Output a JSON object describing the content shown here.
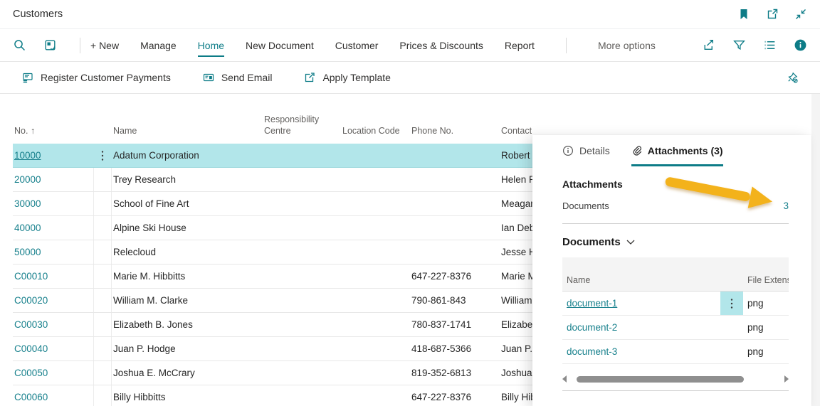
{
  "app_header": {
    "title": "Customers"
  },
  "action_bar": {
    "items": [
      {
        "label": "+ New"
      },
      {
        "label": "Manage"
      },
      {
        "label": "Home",
        "active": true
      },
      {
        "label": "New Document"
      },
      {
        "label": "Customer"
      },
      {
        "label": "Prices & Discounts"
      },
      {
        "label": "Report"
      }
    ],
    "more_options": "More options"
  },
  "toolbar": {
    "buttons": [
      {
        "label": "Register Customer Payments"
      },
      {
        "label": "Send Email"
      },
      {
        "label": "Apply Template"
      }
    ]
  },
  "table": {
    "columns": {
      "no": "No.",
      "sort_indicator": "↑",
      "name": "Name",
      "resp": "Responsibility Centre",
      "loc": "Location Code",
      "phone": "Phone No.",
      "contact": "Contact"
    },
    "rows": [
      {
        "no": "10000",
        "name": "Adatum Corporation",
        "resp": "",
        "loc": "",
        "phone": "",
        "contact": "Robert Townes",
        "selected": true
      },
      {
        "no": "20000",
        "name": "Trey Research",
        "resp": "",
        "loc": "",
        "phone": "",
        "contact": "Helen Ray"
      },
      {
        "no": "30000",
        "name": "School of Fine Art",
        "resp": "",
        "loc": "",
        "phone": "",
        "contact": "Meagan Bond"
      },
      {
        "no": "40000",
        "name": "Alpine Ski House",
        "resp": "",
        "loc": "",
        "phone": "",
        "contact": "Ian Deberry"
      },
      {
        "no": "50000",
        "name": "Relecloud",
        "resp": "",
        "loc": "",
        "phone": "",
        "contact": "Jesse Homer"
      },
      {
        "no": "C00010",
        "name": "Marie M. Hibbitts",
        "resp": "",
        "loc": "",
        "phone": "647-227-8376",
        "contact": "Marie M. Hibbitts"
      },
      {
        "no": "C00020",
        "name": "William M. Clarke",
        "resp": "",
        "loc": "",
        "phone": "790-861-843",
        "contact": "William M. Clarke"
      },
      {
        "no": "C00030",
        "name": "Elizabeth B. Jones",
        "resp": "",
        "loc": "",
        "phone": "780-837-1741",
        "contact": "Elizabeth B. Jones"
      },
      {
        "no": "C00040",
        "name": "Juan P. Hodge",
        "resp": "",
        "loc": "",
        "phone": "418-687-5366",
        "contact": "Juan P. Hodge"
      },
      {
        "no": "C00050",
        "name": "Joshua E. McCrary",
        "resp": "",
        "loc": "",
        "phone": "819-352-6813",
        "contact": "Joshua E. McCrary"
      },
      {
        "no": "C00060",
        "name": "Billy Hibbitts",
        "resp": "",
        "loc": "",
        "phone": "647-227-8376",
        "contact": "Billy Hibbitts"
      }
    ]
  },
  "panel": {
    "tabs": [
      {
        "label": "Details"
      },
      {
        "label": "Attachments (3)",
        "active": true
      }
    ],
    "section_heading": "Attachments",
    "field_label": "Documents",
    "field_value": "3",
    "group_title": "Documents",
    "doc_table": {
      "col_name": "Name",
      "col_ext": "File Extension",
      "rows": [
        {
          "name": "document-1",
          "ext": "png",
          "selected": true
        },
        {
          "name": "document-2",
          "ext": "png"
        },
        {
          "name": "document-3",
          "ext": "png"
        }
      ]
    }
  },
  "colors": {
    "accent": "#0d7c87",
    "link": "#17808c",
    "selection": "#b2e6ea",
    "annotation_arrow": "#f3b21b"
  }
}
